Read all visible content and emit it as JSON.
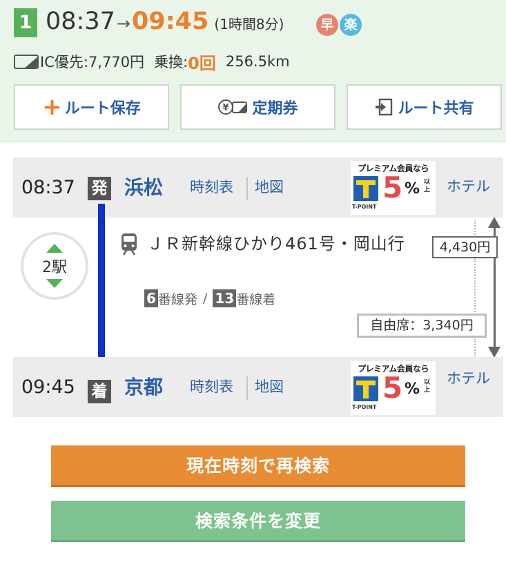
{
  "summary": {
    "route_number": "1",
    "depart_time": "08:37",
    "arrow": "→",
    "arrive_time": "09:45",
    "duration": "(1時間8分)",
    "badges": [
      {
        "label": "早",
        "color": "#e8826b"
      },
      {
        "label": "楽",
        "color": "#5ab7de"
      }
    ],
    "fare_label": "IC優先:",
    "fare_value": "7,770円",
    "transfer_label": "乗換:",
    "transfer_value": "0回",
    "distance": "256.5km",
    "icons": {
      "card": "ic-card-icon"
    }
  },
  "actions": [
    {
      "label": "ルート保存",
      "icon": "plus-icon"
    },
    {
      "label": "定期券",
      "icon": "commuter-pass-icon"
    },
    {
      "label": "ルート共有",
      "icon": "share-icon"
    }
  ],
  "route": {
    "departure": {
      "time": "08:37",
      "flag": "発",
      "station": "浜松",
      "timetable_label": "時刻表",
      "map_label": "地図",
      "hotel_label": "ホテル"
    },
    "arrival": {
      "time": "09:45",
      "flag": "着",
      "station": "京都",
      "timetable_label": "時刻表",
      "map_label": "地図",
      "hotel_label": "ホテル"
    },
    "promo": {
      "headline": "プレミアム会員なら",
      "brand": "T-POINT",
      "percent": "5",
      "unit": "%",
      "suffix": "以上"
    },
    "stops": "2駅",
    "train": {
      "name": "ＪＲ新幹線ひかり461号・岡山行",
      "icon": "train-icon",
      "dep_platform": "6",
      "dep_platform_label": "番線発",
      "separator": "/",
      "arr_platform": "13",
      "arr_platform_label": "番線着"
    },
    "fare": "4,430円",
    "seat_fare": "自由席：3,340円"
  },
  "buttons": {
    "research": "現在時刻で再検索",
    "change": "検索条件を変更"
  },
  "colors": {
    "accent_orange": "#e9812e",
    "link_blue": "#2a5fa8",
    "route_line": "#1330c8",
    "header_bg": "#eaf5ea",
    "green": "#58b05a"
  }
}
